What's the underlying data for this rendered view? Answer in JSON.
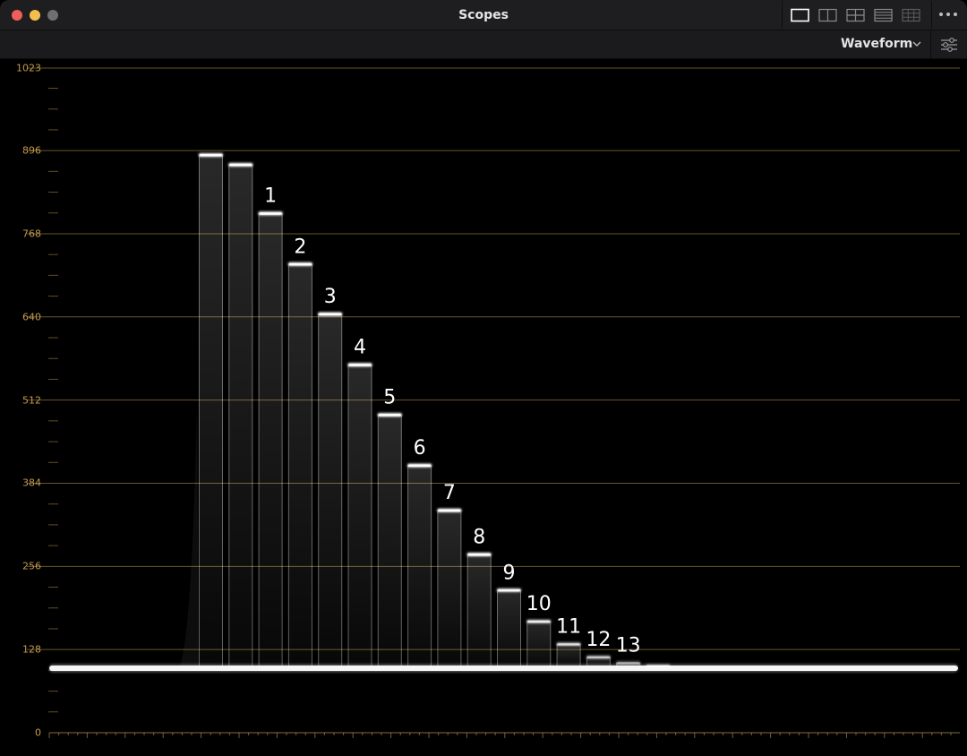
{
  "window": {
    "title": "Scopes"
  },
  "toolbar": {
    "scope_mode": "Waveform",
    "layout_icons": [
      "single-view-icon",
      "dual-view-icon",
      "quad-view-icon",
      "stacked-view-icon",
      "grid-view-icon"
    ],
    "settings_icon": "sliders-icon",
    "more_icon": "more-dots-icon"
  },
  "colors": {
    "graticule": "#c29b4e",
    "trace": "#ffffff",
    "background": "#000000"
  },
  "scale": {
    "min": 0,
    "max": 1023,
    "labels": [
      "1023",
      "896",
      "768",
      "640",
      "512",
      "384",
      "256",
      "128",
      "0"
    ],
    "label_values": [
      1023,
      896,
      768,
      640,
      512,
      384,
      256,
      128,
      0
    ]
  },
  "baseline_level": 100,
  "steps": [
    {
      "label": "",
      "level": 890
    },
    {
      "label": "",
      "level": 875
    },
    {
      "label": "1",
      "level": 800
    },
    {
      "label": "2",
      "level": 722
    },
    {
      "label": "3",
      "level": 645
    },
    {
      "label": "4",
      "level": 567
    },
    {
      "label": "5",
      "level": 490
    },
    {
      "label": "6",
      "level": 412
    },
    {
      "label": "7",
      "level": 343
    },
    {
      "label": "8",
      "level": 275
    },
    {
      "label": "9",
      "level": 220
    },
    {
      "label": "10",
      "level": 172
    },
    {
      "label": "11",
      "level": 137
    },
    {
      "label": "12",
      "level": 117
    },
    {
      "label": "13",
      "level": 108
    },
    {
      "label": "",
      "level": 104
    }
  ]
}
